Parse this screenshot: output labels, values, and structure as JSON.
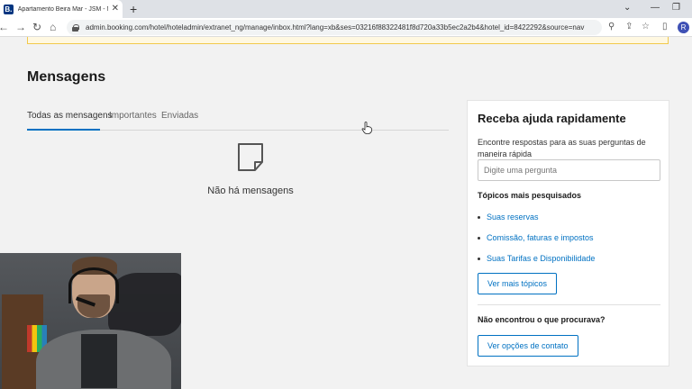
{
  "browser": {
    "tab_title": "Apartamento Beira Mar - JSM - M",
    "favicon_letter": "B.",
    "url": "admin.booking.com/hotel/hoteladmin/extranet_ng/manage/inbox.html?lang=xb&ses=03216f88322481f8d720a33b5ec2a2b4&hotel_id=8422292&source=nav",
    "profile_initial": "R"
  },
  "page": {
    "title": "Mensagens",
    "tabs": [
      {
        "label": "Todas as mensagens",
        "active": true
      },
      {
        "label": "Importantes",
        "active": false
      },
      {
        "label": "Enviadas",
        "active": false
      }
    ],
    "empty_state": "Não há mensagens"
  },
  "help": {
    "title": "Receba ajuda rapidamente",
    "description": "Encontre respostas para as suas perguntas de maneira rápida",
    "search_placeholder": "Digite uma pergunta",
    "topics_title": "Tópicos mais pesquisados",
    "topics": [
      "Suas reservas",
      "Comissão, faturas e impostos",
      "Suas Tarifas e Disponibilidade"
    ],
    "more_topics_button": "Ver mais tópicos",
    "not_found": "Não encontrou o que procurava?",
    "contact_button": "Ver opções de contato"
  },
  "colors": {
    "accent": "#0071c2",
    "notice_border": "#f2c94c"
  }
}
